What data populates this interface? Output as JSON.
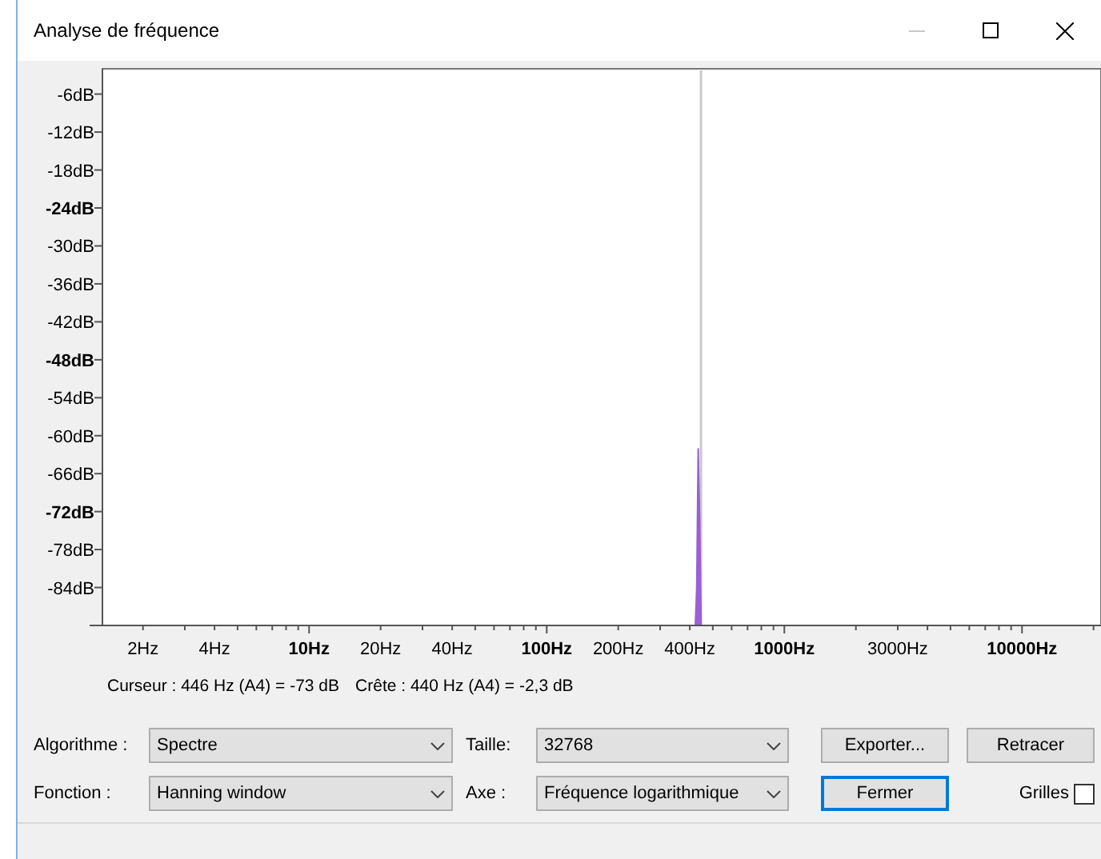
{
  "window": {
    "title": "Analyse de fréquence"
  },
  "plot": {
    "x_labels": [
      {
        "text": "2Hz",
        "major": false
      },
      {
        "text": "4Hz",
        "major": false
      },
      {
        "text": "10Hz",
        "major": true
      },
      {
        "text": "20Hz",
        "major": false
      },
      {
        "text": "40Hz",
        "major": false
      },
      {
        "text": "100Hz",
        "major": true
      },
      {
        "text": "200Hz",
        "major": false
      },
      {
        "text": "400Hz",
        "major": false
      },
      {
        "text": "1000Hz",
        "major": true
      },
      {
        "text": "3000Hz",
        "major": false
      },
      {
        "text": "10000Hz",
        "major": true
      }
    ],
    "y_labels": [
      {
        "text": "-6dB",
        "major": false
      },
      {
        "text": "-12dB",
        "major": false
      },
      {
        "text": "-18dB",
        "major": false
      },
      {
        "text": "-24dB",
        "major": true
      },
      {
        "text": "-30dB",
        "major": false
      },
      {
        "text": "-36dB",
        "major": false
      },
      {
        "text": "-42dB",
        "major": false
      },
      {
        "text": "-48dB",
        "major": true
      },
      {
        "text": "-54dB",
        "major": false
      },
      {
        "text": "-60dB",
        "major": false
      },
      {
        "text": "-66dB",
        "major": false
      },
      {
        "text": "-72dB",
        "major": true
      },
      {
        "text": "-78dB",
        "major": false
      },
      {
        "text": "-84dB",
        "major": false
      }
    ]
  },
  "readout": {
    "cursor": "Curseur : 446 Hz (A4) = -73 dB",
    "peak": "Crête : 440 Hz (A4) = -2,3 dB"
  },
  "fields": [
    {
      "label": "Algorithme :",
      "value": "Spectre"
    },
    {
      "label": "Taille:",
      "value": "32768"
    },
    {
      "label": "Fonction :",
      "value": "Hanning window"
    },
    {
      "label": "Axe :",
      "value": "Fréquence logarithmique"
    }
  ],
  "buttons": [
    {
      "label": "Exporter...",
      "focused": false
    },
    {
      "label": "Retracer",
      "focused": false
    },
    {
      "label": "Fermer",
      "focused": true
    }
  ],
  "grids": {
    "label": "Grilles",
    "checked": false
  }
}
